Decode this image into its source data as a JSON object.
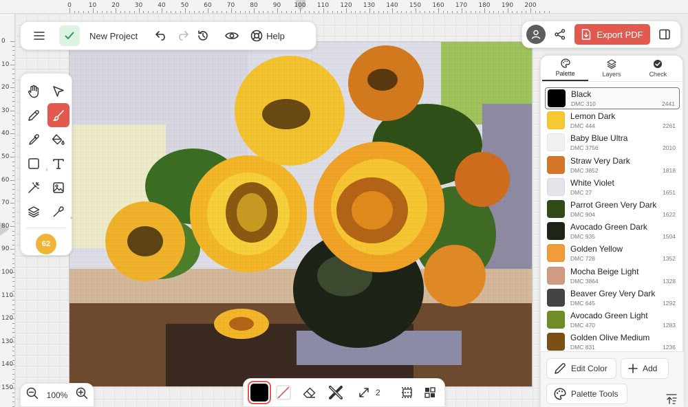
{
  "ruler": {
    "top_labels": [
      "0",
      "10",
      "20",
      "30",
      "40",
      "50",
      "60",
      "70",
      "80",
      "90",
      "100",
      "110",
      "120",
      "130",
      "140",
      "150",
      "160",
      "170",
      "180",
      "190",
      "200"
    ],
    "left_labels": [
      "0",
      "10",
      "20",
      "30",
      "40",
      "50",
      "60",
      "70",
      "80",
      "90",
      "100",
      "110",
      "120",
      "130",
      "140",
      "150"
    ]
  },
  "topbar": {
    "title": "New Project",
    "help_label": "Help"
  },
  "header_actions": {
    "export_label": "Export PDF"
  },
  "toolbox": {
    "color_count": "62"
  },
  "zoom": {
    "level": "100%"
  },
  "bottom_toolbar": {
    "active_color": "#000000",
    "brush_size": "2"
  },
  "palette_panel": {
    "tabs": [
      {
        "label": "Palette",
        "icon": "palette-icon"
      },
      {
        "label": "Layers",
        "icon": "layers-icon"
      },
      {
        "label": "Check",
        "icon": "check-circle-icon"
      }
    ],
    "colors": [
      {
        "name": "Black",
        "code": "DMC 310",
        "count": "2441",
        "hex": "#000000"
      },
      {
        "name": "Lemon Dark",
        "code": "DMC 444",
        "count": "2261",
        "hex": "#f6c931"
      },
      {
        "name": "Baby Blue Ultra",
        "code": "DMC 3756",
        "count": "2010",
        "hex": "#eff1f2"
      },
      {
        "name": "Straw Very Dark",
        "code": "DMC 3852",
        "count": "1818",
        "hex": "#d4762a"
      },
      {
        "name": "White Violet",
        "code": "DMC 27",
        "count": "1651",
        "hex": "#e6e3ec"
      },
      {
        "name": "Parrot Green Very Dark",
        "code": "DMC 904",
        "count": "1622",
        "hex": "#2f4a17"
      },
      {
        "name": "Avocado Green Dark",
        "code": "DMC 935",
        "count": "1504",
        "hex": "#1f2418"
      },
      {
        "name": "Golden Yellow",
        "code": "DMC 728",
        "count": "1352",
        "hex": "#f19c3a"
      },
      {
        "name": "Mocha Beige Light",
        "code": "DMC 3864",
        "count": "1328",
        "hex": "#cf9b83"
      },
      {
        "name": "Beaver Grey Very Dark",
        "code": "DMC 645",
        "count": "1292",
        "hex": "#444444"
      },
      {
        "name": "Avocado Green Light",
        "code": "DMC 470",
        "count": "1283",
        "hex": "#6f8e2a"
      },
      {
        "name": "Golden Olive Medium",
        "code": "DMC 831",
        "count": "1236",
        "hex": "#7a5014"
      }
    ],
    "edit_color_label": "Edit Color",
    "add_label": "Add",
    "palette_tools_label": "Palette Tools"
  },
  "colors": {
    "accent": "#e25a4f",
    "badge": "#f0b438",
    "check_bg": "#def2e3"
  }
}
